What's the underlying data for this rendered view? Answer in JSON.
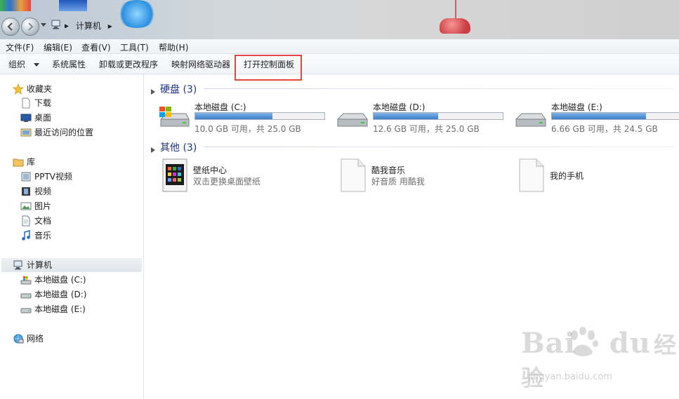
{
  "address": {
    "segments": [
      "计算机"
    ]
  },
  "menu": [
    {
      "label": "文件(F)"
    },
    {
      "label": "编辑(E)"
    },
    {
      "label": "查看(V)"
    },
    {
      "label": "工具(T)"
    },
    {
      "label": "帮助(H)"
    }
  ],
  "toolbar": {
    "organize": "组织",
    "system_properties": "系统属性",
    "uninstall": "卸载或更改程序",
    "map_drive": "映射网络驱动器",
    "control_panel": "打开控制面板"
  },
  "sidebar": {
    "favorites": {
      "label": "收藏夹",
      "items": [
        {
          "label": "下载"
        },
        {
          "label": "桌面"
        },
        {
          "label": "最近访问的位置"
        }
      ]
    },
    "libraries": {
      "label": "库",
      "items": [
        {
          "label": "PPTV视频"
        },
        {
          "label": "视频"
        },
        {
          "label": "图片"
        },
        {
          "label": "文档"
        },
        {
          "label": "音乐"
        }
      ]
    },
    "computer": {
      "label": "计算机",
      "items": [
        {
          "label": "本地磁盘 (C:)"
        },
        {
          "label": "本地磁盘 (D:)"
        },
        {
          "label": "本地磁盘 (E:)"
        }
      ]
    },
    "network": {
      "label": "网络"
    }
  },
  "content": {
    "hard_disks": {
      "heading": "硬盘 (3)",
      "drives": [
        {
          "name": "本地磁盘 (C:)",
          "info": "10.0 GB 可用，共 25.0 GB",
          "used_fraction": 0.6
        },
        {
          "name": "本地磁盘 (D:)",
          "info": "12.6 GB 可用，共 25.0 GB",
          "used_fraction": 0.5
        },
        {
          "name": "本地磁盘 (E:)",
          "info": "6.66 GB 可用，共 24.5 GB",
          "used_fraction": 0.73
        }
      ]
    },
    "others": {
      "heading": "其他 (3)",
      "items": [
        {
          "name": "壁纸中心",
          "desc": "双击更换桌面壁纸"
        },
        {
          "name": "酷我音乐",
          "desc": "好音质 用酷我"
        },
        {
          "name": "我的手机",
          "desc": ""
        }
      ]
    }
  },
  "watermark": {
    "brand": "Bai",
    "brand2": "du",
    "brand_cn": "经验",
    "url": "jingyan.baidu.com"
  },
  "colors": {
    "highlight": "#e64545",
    "group_heading": "#1e3287",
    "drive_fill": "#3d7fc8"
  }
}
